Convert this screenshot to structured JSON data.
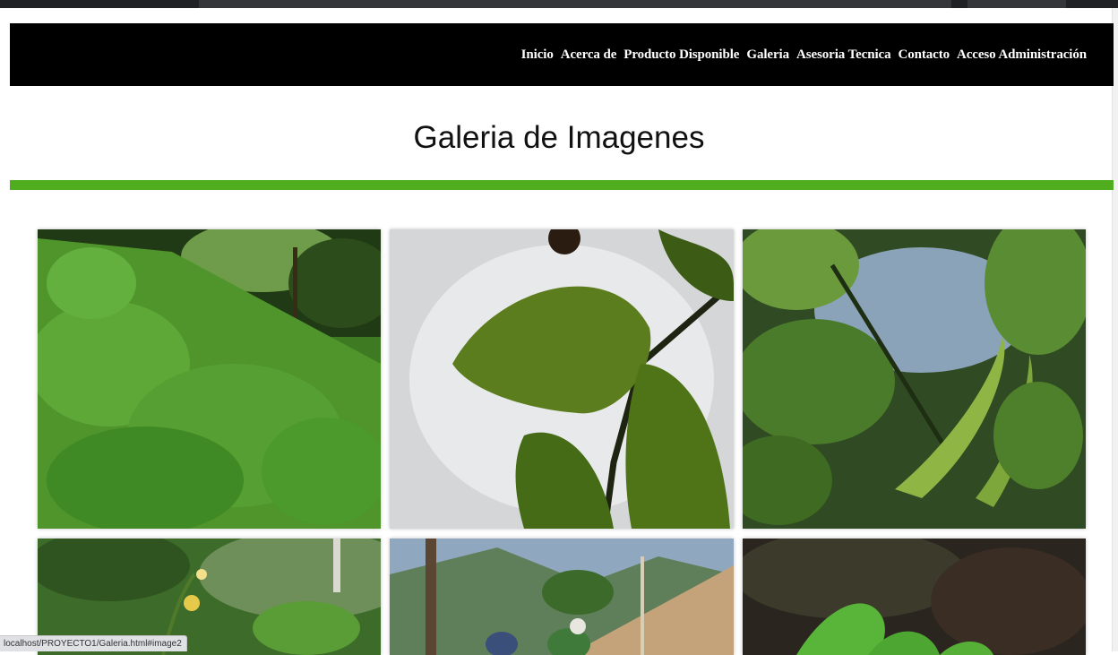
{
  "nav": {
    "items": [
      {
        "label": "Inicio"
      },
      {
        "label": "Acerca de"
      },
      {
        "label": "Producto Disponible"
      },
      {
        "label": "Galeria"
      },
      {
        "label": "Asesoria Tecnica"
      },
      {
        "label": "Contacto"
      },
      {
        "label": "Acceso Administración"
      }
    ]
  },
  "page": {
    "title": "Galeria de Imagenes"
  },
  "status_bar": {
    "url": "localhost/PROYECTO1/Galeria.html#image2"
  },
  "colors": {
    "navbar": "#000000",
    "accent_rule": "#4fad1e"
  }
}
